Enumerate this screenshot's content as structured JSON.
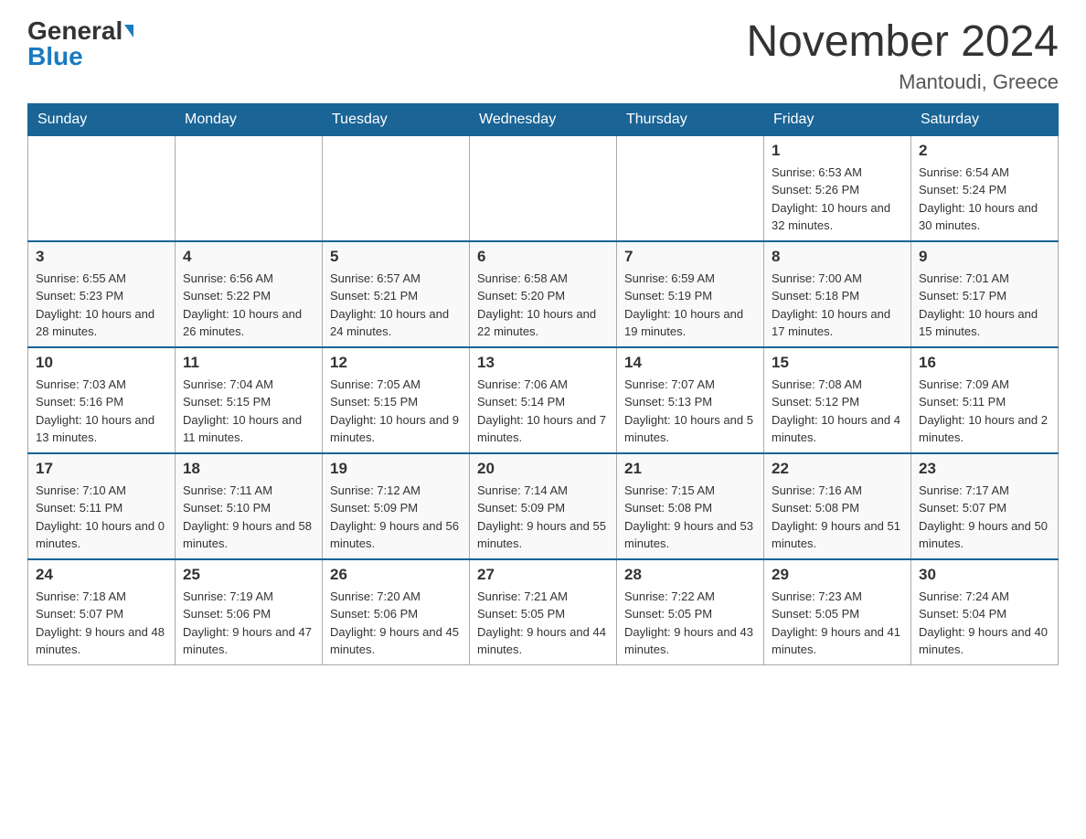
{
  "header": {
    "logo_general": "General",
    "logo_blue": "Blue",
    "month_title": "November 2024",
    "location": "Mantoudi, Greece"
  },
  "weekdays": [
    "Sunday",
    "Monday",
    "Tuesday",
    "Wednesday",
    "Thursday",
    "Friday",
    "Saturday"
  ],
  "weeks": [
    [
      {
        "day": "",
        "sunrise": "",
        "sunset": "",
        "daylight": ""
      },
      {
        "day": "",
        "sunrise": "",
        "sunset": "",
        "daylight": ""
      },
      {
        "day": "",
        "sunrise": "",
        "sunset": "",
        "daylight": ""
      },
      {
        "day": "",
        "sunrise": "",
        "sunset": "",
        "daylight": ""
      },
      {
        "day": "",
        "sunrise": "",
        "sunset": "",
        "daylight": ""
      },
      {
        "day": "1",
        "sunrise": "Sunrise: 6:53 AM",
        "sunset": "Sunset: 5:26 PM",
        "daylight": "Daylight: 10 hours and 32 minutes."
      },
      {
        "day": "2",
        "sunrise": "Sunrise: 6:54 AM",
        "sunset": "Sunset: 5:24 PM",
        "daylight": "Daylight: 10 hours and 30 minutes."
      }
    ],
    [
      {
        "day": "3",
        "sunrise": "Sunrise: 6:55 AM",
        "sunset": "Sunset: 5:23 PM",
        "daylight": "Daylight: 10 hours and 28 minutes."
      },
      {
        "day": "4",
        "sunrise": "Sunrise: 6:56 AM",
        "sunset": "Sunset: 5:22 PM",
        "daylight": "Daylight: 10 hours and 26 minutes."
      },
      {
        "day": "5",
        "sunrise": "Sunrise: 6:57 AM",
        "sunset": "Sunset: 5:21 PM",
        "daylight": "Daylight: 10 hours and 24 minutes."
      },
      {
        "day": "6",
        "sunrise": "Sunrise: 6:58 AM",
        "sunset": "Sunset: 5:20 PM",
        "daylight": "Daylight: 10 hours and 22 minutes."
      },
      {
        "day": "7",
        "sunrise": "Sunrise: 6:59 AM",
        "sunset": "Sunset: 5:19 PM",
        "daylight": "Daylight: 10 hours and 19 minutes."
      },
      {
        "day": "8",
        "sunrise": "Sunrise: 7:00 AM",
        "sunset": "Sunset: 5:18 PM",
        "daylight": "Daylight: 10 hours and 17 minutes."
      },
      {
        "day": "9",
        "sunrise": "Sunrise: 7:01 AM",
        "sunset": "Sunset: 5:17 PM",
        "daylight": "Daylight: 10 hours and 15 minutes."
      }
    ],
    [
      {
        "day": "10",
        "sunrise": "Sunrise: 7:03 AM",
        "sunset": "Sunset: 5:16 PM",
        "daylight": "Daylight: 10 hours and 13 minutes."
      },
      {
        "day": "11",
        "sunrise": "Sunrise: 7:04 AM",
        "sunset": "Sunset: 5:15 PM",
        "daylight": "Daylight: 10 hours and 11 minutes."
      },
      {
        "day": "12",
        "sunrise": "Sunrise: 7:05 AM",
        "sunset": "Sunset: 5:15 PM",
        "daylight": "Daylight: 10 hours and 9 minutes."
      },
      {
        "day": "13",
        "sunrise": "Sunrise: 7:06 AM",
        "sunset": "Sunset: 5:14 PM",
        "daylight": "Daylight: 10 hours and 7 minutes."
      },
      {
        "day": "14",
        "sunrise": "Sunrise: 7:07 AM",
        "sunset": "Sunset: 5:13 PM",
        "daylight": "Daylight: 10 hours and 5 minutes."
      },
      {
        "day": "15",
        "sunrise": "Sunrise: 7:08 AM",
        "sunset": "Sunset: 5:12 PM",
        "daylight": "Daylight: 10 hours and 4 minutes."
      },
      {
        "day": "16",
        "sunrise": "Sunrise: 7:09 AM",
        "sunset": "Sunset: 5:11 PM",
        "daylight": "Daylight: 10 hours and 2 minutes."
      }
    ],
    [
      {
        "day": "17",
        "sunrise": "Sunrise: 7:10 AM",
        "sunset": "Sunset: 5:11 PM",
        "daylight": "Daylight: 10 hours and 0 minutes."
      },
      {
        "day": "18",
        "sunrise": "Sunrise: 7:11 AM",
        "sunset": "Sunset: 5:10 PM",
        "daylight": "Daylight: 9 hours and 58 minutes."
      },
      {
        "day": "19",
        "sunrise": "Sunrise: 7:12 AM",
        "sunset": "Sunset: 5:09 PM",
        "daylight": "Daylight: 9 hours and 56 minutes."
      },
      {
        "day": "20",
        "sunrise": "Sunrise: 7:14 AM",
        "sunset": "Sunset: 5:09 PM",
        "daylight": "Daylight: 9 hours and 55 minutes."
      },
      {
        "day": "21",
        "sunrise": "Sunrise: 7:15 AM",
        "sunset": "Sunset: 5:08 PM",
        "daylight": "Daylight: 9 hours and 53 minutes."
      },
      {
        "day": "22",
        "sunrise": "Sunrise: 7:16 AM",
        "sunset": "Sunset: 5:08 PM",
        "daylight": "Daylight: 9 hours and 51 minutes."
      },
      {
        "day": "23",
        "sunrise": "Sunrise: 7:17 AM",
        "sunset": "Sunset: 5:07 PM",
        "daylight": "Daylight: 9 hours and 50 minutes."
      }
    ],
    [
      {
        "day": "24",
        "sunrise": "Sunrise: 7:18 AM",
        "sunset": "Sunset: 5:07 PM",
        "daylight": "Daylight: 9 hours and 48 minutes."
      },
      {
        "day": "25",
        "sunrise": "Sunrise: 7:19 AM",
        "sunset": "Sunset: 5:06 PM",
        "daylight": "Daylight: 9 hours and 47 minutes."
      },
      {
        "day": "26",
        "sunrise": "Sunrise: 7:20 AM",
        "sunset": "Sunset: 5:06 PM",
        "daylight": "Daylight: 9 hours and 45 minutes."
      },
      {
        "day": "27",
        "sunrise": "Sunrise: 7:21 AM",
        "sunset": "Sunset: 5:05 PM",
        "daylight": "Daylight: 9 hours and 44 minutes."
      },
      {
        "day": "28",
        "sunrise": "Sunrise: 7:22 AM",
        "sunset": "Sunset: 5:05 PM",
        "daylight": "Daylight: 9 hours and 43 minutes."
      },
      {
        "day": "29",
        "sunrise": "Sunrise: 7:23 AM",
        "sunset": "Sunset: 5:05 PM",
        "daylight": "Daylight: 9 hours and 41 minutes."
      },
      {
        "day": "30",
        "sunrise": "Sunrise: 7:24 AM",
        "sunset": "Sunset: 5:04 PM",
        "daylight": "Daylight: 9 hours and 40 minutes."
      }
    ]
  ]
}
